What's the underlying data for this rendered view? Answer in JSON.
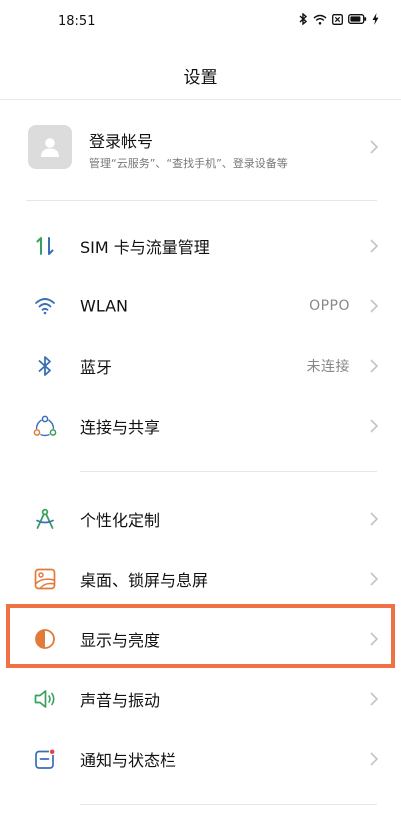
{
  "status_bar": {
    "time": "18:51",
    "icons": [
      "bluetooth-icon",
      "wifi-icon",
      "sim-icon",
      "battery-icon",
      "charging-icon"
    ]
  },
  "header": {
    "title": "设置"
  },
  "account": {
    "title": "登录帐号",
    "subtitle": "管理“云服务”、“查找手机”、登录设备等"
  },
  "settings": {
    "sim": {
      "label": "SIM 卡与流量管理",
      "icon": "sim-data-icon"
    },
    "wlan": {
      "label": "WLAN",
      "value": "OPPO",
      "icon": "wifi-icon"
    },
    "bluetooth": {
      "label": "蓝牙",
      "value": "未连接",
      "icon": "bluetooth-icon"
    },
    "connection": {
      "label": "连接与共享",
      "icon": "share-icon"
    },
    "personalize": {
      "label": "个性化定制",
      "icon": "compass-icon"
    },
    "desktop": {
      "label": "桌面、锁屏与息屏",
      "icon": "wallpaper-icon"
    },
    "display": {
      "label": "显示与亮度",
      "icon": "brightness-icon"
    },
    "sound": {
      "label": "声音与振动",
      "icon": "speaker-icon"
    },
    "notification": {
      "label": "通知与状态栏",
      "icon": "notification-icon"
    }
  },
  "colors": {
    "highlight": "#ef7146",
    "icon_blue": "#3a6fb6",
    "icon_green": "#37a05a",
    "icon_orange": "#e27a3a",
    "icon_red": "#e0464a"
  }
}
